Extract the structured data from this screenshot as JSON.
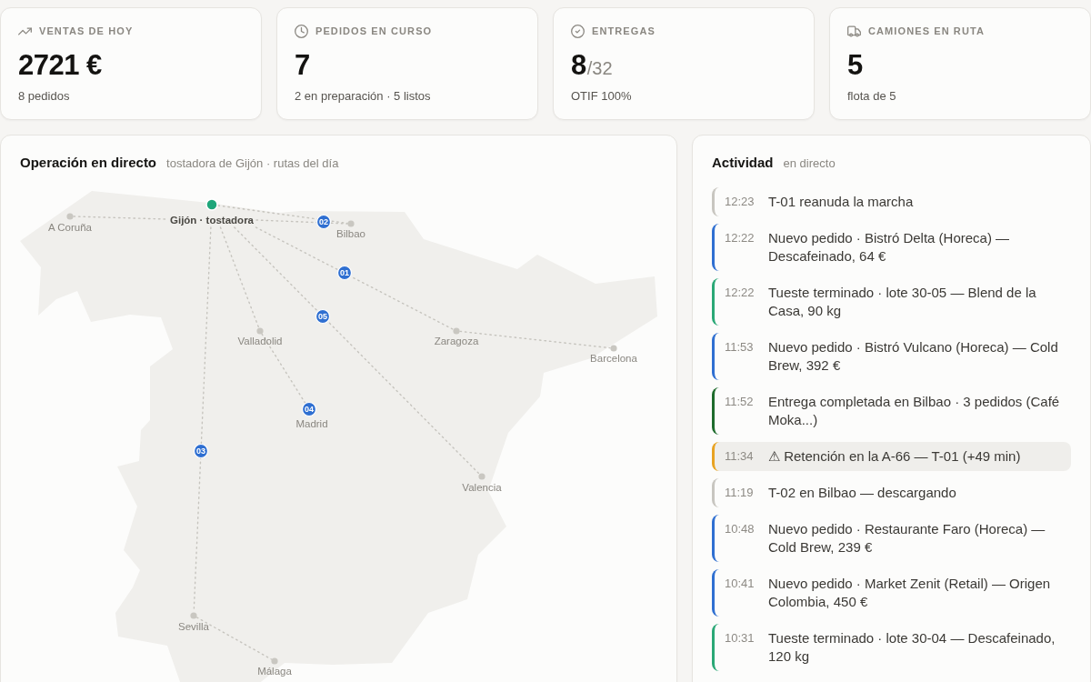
{
  "kpis": [
    {
      "kind": "sales",
      "label": "VENTAS DE HOY",
      "value": "2721 €",
      "detail": "8 pedidos"
    },
    {
      "kind": "orders",
      "label": "PEDIDOS EN CURSO",
      "value": "7",
      "detail": "2 en preparación · 5 listos"
    },
    {
      "kind": "deliveries",
      "label": "ENTREGAS",
      "value": "8",
      "total": "/32",
      "detail": "OTIF 100%"
    },
    {
      "kind": "fleet",
      "label": "CAMIONES EN RUTA",
      "value": "5",
      "detail": "flota de 5"
    }
  ],
  "operations": {
    "title": "Operación en directo",
    "subtitle": "tostadora de Gijón · rutas del día",
    "map": {
      "origin": "Gijón · tostadora",
      "cities": [
        {
          "name": "A Coruña"
        },
        {
          "name": "Bilbao"
        },
        {
          "name": "Valladolid"
        },
        {
          "name": "Zaragoza"
        },
        {
          "name": "Barcelona"
        },
        {
          "name": "Madrid"
        },
        {
          "name": "Valencia"
        },
        {
          "name": "Sevilla"
        },
        {
          "name": "Málaga"
        }
      ],
      "trucks": [
        {
          "label": "02"
        },
        {
          "label": "01"
        },
        {
          "label": "05"
        },
        {
          "label": "04"
        },
        {
          "label": "03"
        }
      ]
    }
  },
  "activity": {
    "title": "Actividad",
    "subtitle": "en directo",
    "events": [
      {
        "time": "12:23",
        "text": "T-01 reanuda la marcha",
        "color": "#c8c6c0",
        "highlighted": false
      },
      {
        "time": "12:22",
        "text": "Nuevo pedido · Bistró Delta (Horeca) — Descafeinado, 64 €",
        "color": "#2f6fd1",
        "highlighted": false
      },
      {
        "time": "12:22",
        "text": "Tueste terminado · lote 30-05 — Blend de la Casa, 90 kg",
        "color": "#2aa876",
        "highlighted": false
      },
      {
        "time": "11:53",
        "text": "Nuevo pedido · Bistró Vulcano (Horeca) — Cold Brew, 392 €",
        "color": "#2f6fd1",
        "highlighted": false
      },
      {
        "time": "11:52",
        "text": "Entrega completada en Bilbao · 3 pedidos (Café Moka...)",
        "color": "#1e6b2c",
        "highlighted": false
      },
      {
        "time": "11:34",
        "text": "⚠ Retención en la A-66 — T-01 (+49 min)",
        "color": "#e8a322",
        "highlighted": true
      },
      {
        "time": "11:19",
        "text": "T-02 en Bilbao — descargando",
        "color": "#c8c6c0",
        "highlighted": false
      },
      {
        "time": "10:48",
        "text": "Nuevo pedido · Restaurante Faro (Horeca) — Cold Brew, 239 €",
        "color": "#2f6fd1",
        "highlighted": false
      },
      {
        "time": "10:41",
        "text": "Nuevo pedido · Market Zenit (Retail) — Origen Colombia, 450 €",
        "color": "#2f6fd1",
        "highlighted": false
      },
      {
        "time": "10:31",
        "text": "Tueste terminado · lote 30-04 — Descafeinado, 120 kg",
        "color": "#2aa876",
        "highlighted": false
      }
    ]
  }
}
